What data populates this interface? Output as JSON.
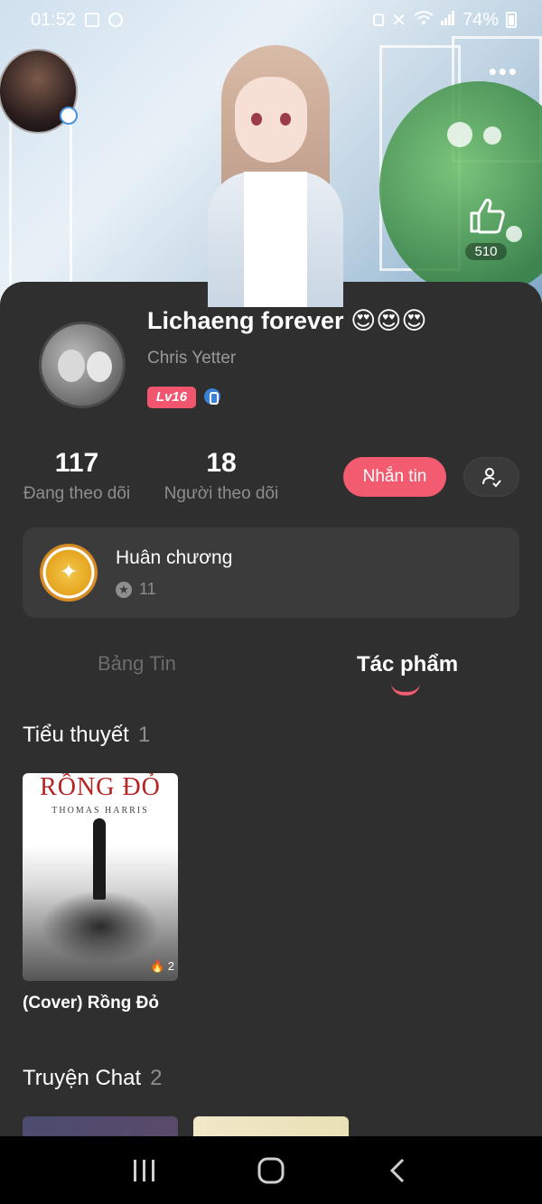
{
  "status_bar": {
    "time": "01:52",
    "battery": "74%"
  },
  "banner": {
    "like_count": "510",
    "more_glyph": "•••"
  },
  "profile": {
    "name": "Lichaeng forever 😍😍😍",
    "username": "Chris Yetter",
    "level": "Lv16"
  },
  "stats": [
    {
      "value": "117",
      "label": "Đang theo dõi"
    },
    {
      "value": "18",
      "label": "Người theo dõi"
    }
  ],
  "actions": {
    "message_label": "Nhắn tin"
  },
  "medal": {
    "title": "Huân chương",
    "count": "11"
  },
  "tabs": [
    {
      "label": "Bảng Tin",
      "active": false
    },
    {
      "label": "Tác phẩm",
      "active": true
    }
  ],
  "sections": {
    "novels": {
      "title": "Tiểu thuyết",
      "count": "1",
      "items": [
        {
          "cover_title": "RỒNG ĐỎ",
          "cover_author": "THOMAS HARRIS",
          "fire_count": "2",
          "name": "(Cover) Rồng Đỏ"
        }
      ]
    },
    "chat_stories": {
      "title": "Truyện Chat",
      "count": "2"
    }
  },
  "colors": {
    "accent": "#f35c70",
    "background": "#2f2f2f",
    "card": "#3b3b3b",
    "muted_text": "#8e8e8e"
  },
  "icons": {
    "like": "thumbs-up-icon",
    "follow": "user-check-icon",
    "medal": "medal-icon",
    "nav_recents": "recents-icon",
    "nav_home": "home-icon",
    "nav_back": "back-icon"
  }
}
